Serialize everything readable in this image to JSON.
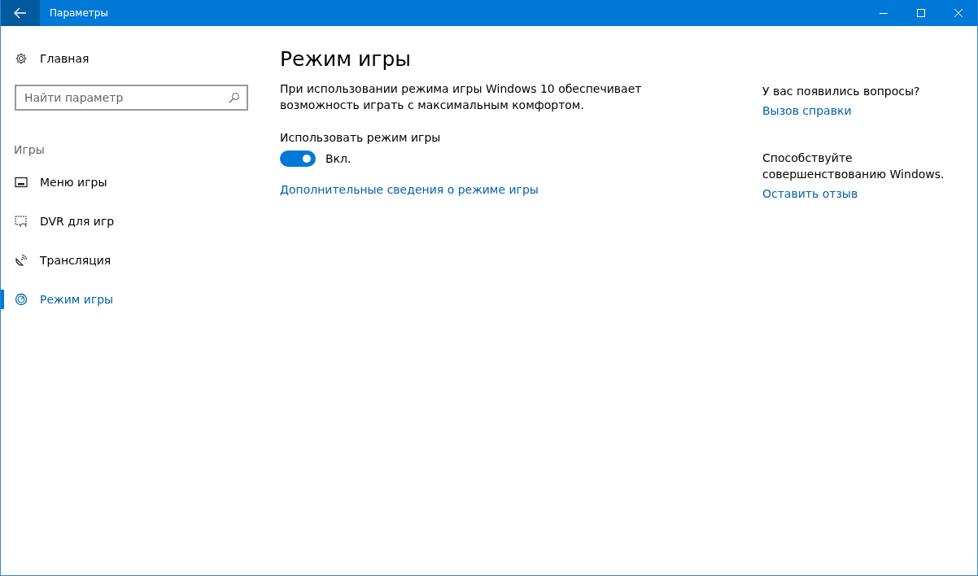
{
  "window": {
    "title": "Параметры"
  },
  "sidebar": {
    "home": "Главная",
    "search": {
      "placeholder": "Найти параметр"
    },
    "section": "Игры",
    "items": [
      {
        "label": "Меню игры",
        "kind": "menu",
        "selected": false
      },
      {
        "label": "DVR для игр",
        "kind": "dvr",
        "selected": false
      },
      {
        "label": "Трансляция",
        "kind": "broadcast",
        "selected": false
      },
      {
        "label": "Режим игры",
        "kind": "gauge",
        "selected": true
      }
    ]
  },
  "main": {
    "title": "Режим игры",
    "description": "При использовании режима игры Windows 10 обеспечивает возможность играть с максимальным комфортом.",
    "setting": {
      "label": "Использовать режим игры",
      "on": true,
      "state_text": "Вкл."
    },
    "link": "Дополнительные сведения о режиме игры"
  },
  "aside": [
    {
      "heading": "У вас появились вопросы?",
      "link": "Вызов справки"
    },
    {
      "heading": "Способствуйте совершенствованию Windows.",
      "link": "Оставить отзыв"
    }
  ]
}
